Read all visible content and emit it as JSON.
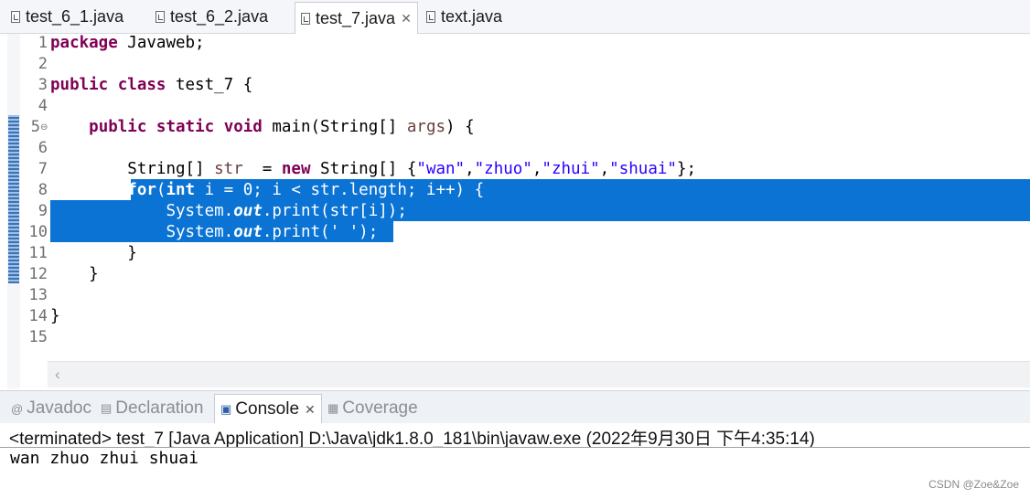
{
  "editor_tabs": [
    {
      "label": "test_6_1.java",
      "active": false
    },
    {
      "label": "test_6_2.java",
      "active": false
    },
    {
      "label": "test_7.java",
      "active": true
    },
    {
      "label": "text.java",
      "active": false
    }
  ],
  "tab_close_glyph": "✕",
  "line_numbers": [
    "1",
    "2",
    "3",
    "4",
    "5",
    "6",
    "7",
    "8",
    "9",
    "10",
    "11",
    "12",
    "13",
    "14",
    "15"
  ],
  "code": {
    "l1_kw": "package",
    "l1_rest": " Javaweb;",
    "l3_kw1": "public",
    "l3_kw2": "class",
    "l3_rest": " test_7 {",
    "l5_indent": "    ",
    "l5_kw1": "public",
    "l5_kw2": "static",
    "l5_kw3": "void",
    "l5_mid": " main(String[] ",
    "l5_var": "args",
    "l5_end": ") {",
    "l7_indent": "        ",
    "l7_a": "String[] ",
    "l7_var": "str",
    "l7_b": "  = ",
    "l7_kw": "new",
    "l7_c": " String[] {",
    "l7_s1": "\"wan\"",
    "l7_s2": "\"zhuo\"",
    "l7_s3": "\"zhui\"",
    "l7_s4": "\"shuai\"",
    "l7_comma": ",",
    "l7_end": "};",
    "l8_indent": "        ",
    "l8_kw1": "for",
    "l8_a": "(",
    "l8_kw2": "int",
    "l8_rest": " i = 0; i < str.length; i++) {",
    "l9_indent": "            ",
    "l9_a": "System.",
    "l9_field": "out",
    "l9_rest": ".print(str[i]);",
    "l10_indent": "            ",
    "l10_a": "System.",
    "l10_field": "out",
    "l10_rest": ".print(' ');",
    "l11": "        }",
    "l12": "    }",
    "l14": "}"
  },
  "view_tabs": [
    {
      "label": "Javadoc",
      "icon": "@"
    },
    {
      "label": "Declaration",
      "icon": "declaration-icon"
    },
    {
      "label": "Console",
      "icon": "console-icon",
      "active": true
    },
    {
      "label": "Coverage",
      "icon": "coverage-icon"
    }
  ],
  "console": {
    "header": "<terminated> test_7 [Java Application] D:\\Java\\jdk1.8.0_181\\bin\\javaw.exe (2022年9月30日 下午4:35:14)",
    "output": "wan zhuo zhui shuai"
  },
  "watermark": "CSDN @Zoe&Zoe",
  "colors": {
    "selection": "#0a73d4",
    "keyword": "#7f0055",
    "string": "#2a00ff",
    "field": "#0000c0"
  }
}
